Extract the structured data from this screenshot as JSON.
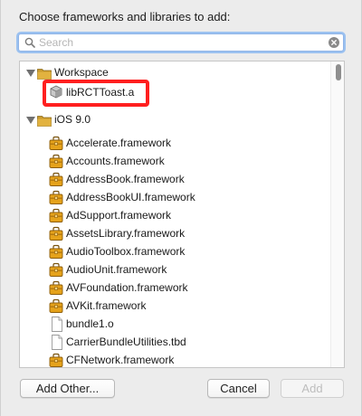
{
  "dialog": {
    "prompt": "Choose frameworks and libraries to add:"
  },
  "search": {
    "placeholder": "Search",
    "value": ""
  },
  "tree": {
    "workspace": {
      "label": "Workspace",
      "items": [
        {
          "label": "libRCTToast.a",
          "icon": "static-library-icon"
        }
      ]
    },
    "sdk": {
      "label": "iOS 9.0",
      "items": [
        {
          "label": "Accelerate.framework",
          "icon": "framework-icon"
        },
        {
          "label": "Accounts.framework",
          "icon": "framework-icon"
        },
        {
          "label": "AddressBook.framework",
          "icon": "framework-icon"
        },
        {
          "label": "AddressBookUI.framework",
          "icon": "framework-icon"
        },
        {
          "label": "AdSupport.framework",
          "icon": "framework-icon"
        },
        {
          "label": "AssetsLibrary.framework",
          "icon": "framework-icon"
        },
        {
          "label": "AudioToolbox.framework",
          "icon": "framework-icon"
        },
        {
          "label": "AudioUnit.framework",
          "icon": "framework-icon"
        },
        {
          "label": "AVFoundation.framework",
          "icon": "framework-icon"
        },
        {
          "label": "AVKit.framework",
          "icon": "framework-icon"
        },
        {
          "label": "bundle1.o",
          "icon": "document-icon"
        },
        {
          "label": "CarrierBundleUtilities.tbd",
          "icon": "document-icon"
        },
        {
          "label": "CFNetwork.framework",
          "icon": "framework-icon"
        }
      ]
    }
  },
  "buttons": {
    "add_other": "Add Other...",
    "cancel": "Cancel",
    "add": "Add"
  },
  "colors": {
    "highlight": "#ff1f1f",
    "focus_ring": "#9cc2f0",
    "framework_icon": "#e5a21a"
  }
}
